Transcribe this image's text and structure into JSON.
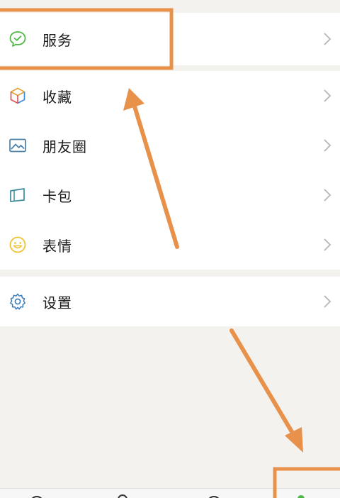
{
  "menu": {
    "services": {
      "label": "服务",
      "icon": "wechat-check-icon",
      "color": "#4fb848"
    },
    "main_items": [
      {
        "label": "收藏",
        "icon": "cube-icon"
      },
      {
        "label": "朋友圈",
        "icon": "image-icon"
      },
      {
        "label": "卡包",
        "icon": "wallet-icon"
      },
      {
        "label": "表情",
        "icon": "smile-icon"
      }
    ],
    "settings": {
      "label": "设置",
      "icon": "gear-icon"
    }
  },
  "colors": {
    "annotation": "#e8914a",
    "background": "#f3f2ef",
    "row_background": "#ffffff",
    "chevron": "#b5b5b5"
  }
}
